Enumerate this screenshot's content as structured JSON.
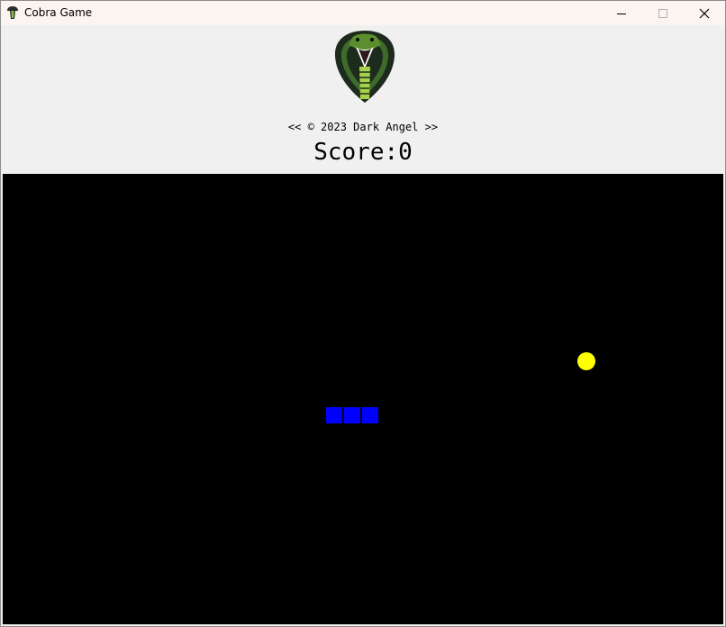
{
  "window": {
    "title": "Cobra Game",
    "icons": {
      "app": "cobra-icon",
      "minimize": "minimize-icon",
      "maximize": "maximize-icon",
      "close": "close-icon"
    }
  },
  "header": {
    "logo_icon": "cobra-logo",
    "copyright": "<< © 2023 Dark Angel >>",
    "score_text": "Score:0"
  },
  "game": {
    "background": "#000000",
    "snake_color": "#0000ff",
    "food_color": "#ffff00",
    "snake_segments": 3
  }
}
